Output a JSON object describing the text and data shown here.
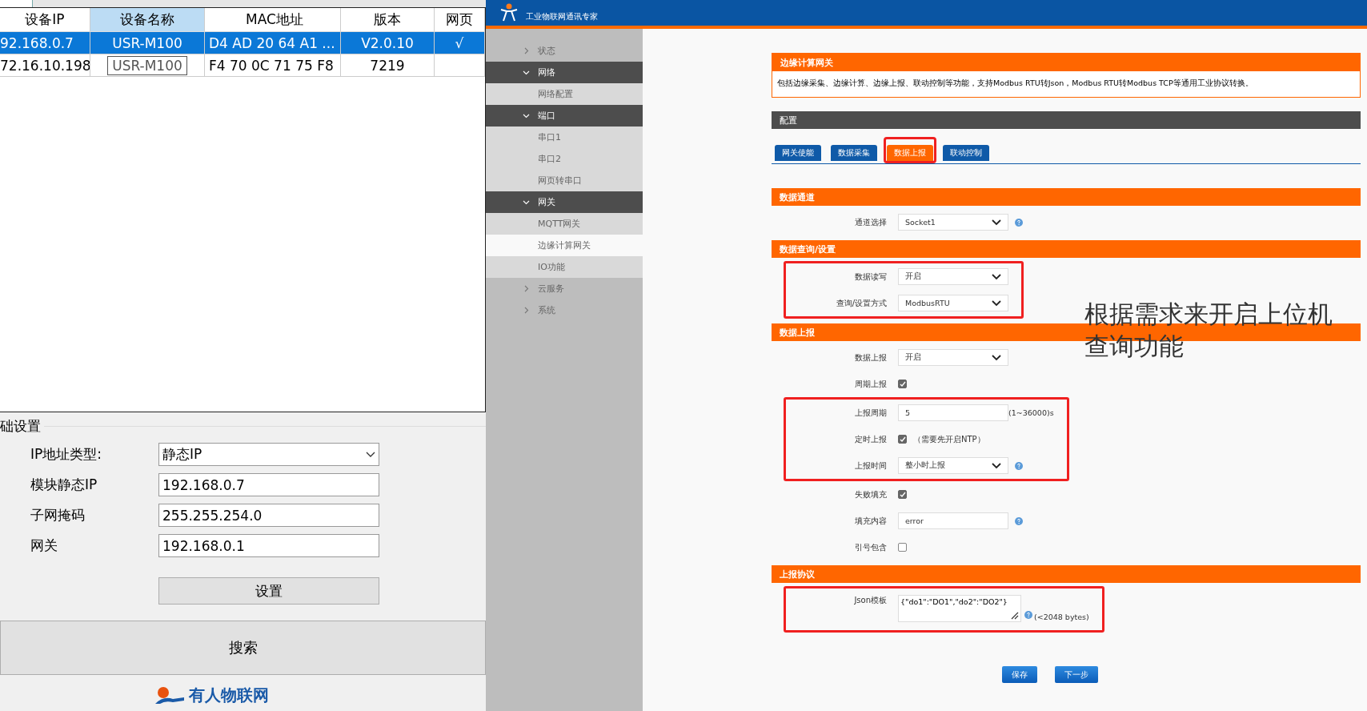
{
  "device_table": {
    "columns": [
      {
        "label": "设备IP",
        "selected": false
      },
      {
        "label": "设备名称",
        "selected": true
      },
      {
        "label": "MAC地址",
        "selected": false
      },
      {
        "label": "版本",
        "selected": false
      },
      {
        "label": "网页",
        "selected": false
      }
    ],
    "rows": [
      {
        "cells": [
          "92.168.0.7",
          "USR-M100",
          "D4 AD 20 64 A1 ...",
          "V2.0.10",
          "√"
        ],
        "selected": true
      },
      {
        "cells": [
          "72.16.10.198",
          "USR-M100",
          "F4 70 0C 71 75 F8",
          "7219"
        ],
        "selected": false
      }
    ]
  },
  "basic_settings": {
    "title": "础设置",
    "fields": [
      {
        "kind": "select",
        "label": "IP地址类型:",
        "value": "静态IP"
      },
      {
        "kind": "input",
        "label": "模块静态IP",
        "value": "192.168.0.7"
      },
      {
        "kind": "input",
        "label": "子网掩码",
        "value": "255.255.254.0"
      },
      {
        "kind": "input",
        "label": "网关",
        "value": "192.168.0.1"
      }
    ],
    "button": "设置"
  },
  "search_button": "搜索",
  "bottom_logo": "有人物联网",
  "web": {
    "tagline": "工业物联网通讯专家",
    "nav": [
      {
        "label": "状态",
        "expanded": false
      },
      {
        "label": "网络",
        "expanded": true,
        "children": [
          {
            "label": "网络配置",
            "selected": false
          }
        ]
      },
      {
        "label": "端口",
        "expanded": true,
        "children": [
          {
            "label": "串口1",
            "selected": false
          },
          {
            "label": "串口2",
            "selected": false
          },
          {
            "label": "网页转串口",
            "selected": false
          }
        ]
      },
      {
        "label": "网关",
        "expanded": true,
        "children": [
          {
            "label": "MQTT网关",
            "selected": false
          },
          {
            "label": "边缘计算网关",
            "selected": true
          },
          {
            "label": "IO功能",
            "selected": false
          }
        ]
      },
      {
        "label": "云服务",
        "expanded": false
      },
      {
        "label": "系统",
        "expanded": false
      }
    ],
    "intro": {
      "title": "边缘计算网关",
      "text": "包括边缘采集、边缘计算、边缘上报、联动控制等功能，支持Modbus RTU转Json，Modbus RTU转Modbus TCP等通用工业协议转换。"
    },
    "config_title": "配置",
    "tabs": [
      {
        "label": "网关使能",
        "selected": false,
        "highlighted": false
      },
      {
        "label": "数据采集",
        "selected": false,
        "highlighted": false
      },
      {
        "label": "数据上报",
        "selected": true,
        "highlighted": true
      },
      {
        "label": "联动控制",
        "selected": false,
        "highlighted": false
      }
    ],
    "sections": [
      {
        "title": "数据通道",
        "rows": [
          {
            "kind": "select",
            "label": "通道选择",
            "value": "Socket1",
            "help": true,
            "highlighted": false
          }
        ]
      },
      {
        "title": "数据查询/设置",
        "rows": [
          {
            "kind": "select",
            "label": "数据读写",
            "value": "开启",
            "highlighted": true
          },
          {
            "kind": "select",
            "label": "查询/设置方式",
            "value": "ModbusRTU",
            "highlighted": true
          }
        ]
      },
      {
        "title": "数据上报",
        "rows": [
          {
            "kind": "select",
            "label": "数据上报",
            "value": "开启",
            "highlighted": false
          },
          {
            "kind": "checkbox",
            "label": "周期上报",
            "checked": true,
            "highlighted": false
          },
          {
            "kind": "input",
            "label": "上报周期",
            "value": "5",
            "suffix": "(1~36000)s",
            "highlighted": true
          },
          {
            "kind": "checkbox",
            "label": "定时上报",
            "checked": true,
            "note": "（需要先开启NTP）",
            "highlighted": true
          },
          {
            "kind": "select",
            "label": "上报时间",
            "value": "整小时上报",
            "help": true,
            "highlighted": true
          },
          {
            "kind": "checkbox",
            "label": "失败填充",
            "checked": true,
            "highlighted": false
          },
          {
            "kind": "input",
            "label": "填充内容",
            "value": "error",
            "help": true,
            "highlighted": false
          },
          {
            "kind": "checkbox",
            "label": "引号包含",
            "checked": false,
            "highlighted": false
          }
        ]
      },
      {
        "title": "上报协议",
        "rows": [
          {
            "kind": "textarea",
            "label": "Json模板",
            "value": "{\"do1\":\"DO1\",\"do2\":\"DO2\"}",
            "help": true,
            "suffix": "(<2048 bytes)",
            "highlighted": true
          }
        ]
      }
    ],
    "buttons": [
      "保存",
      "下一步"
    ],
    "annotation": "根据需求来开启上位机查询功能"
  }
}
